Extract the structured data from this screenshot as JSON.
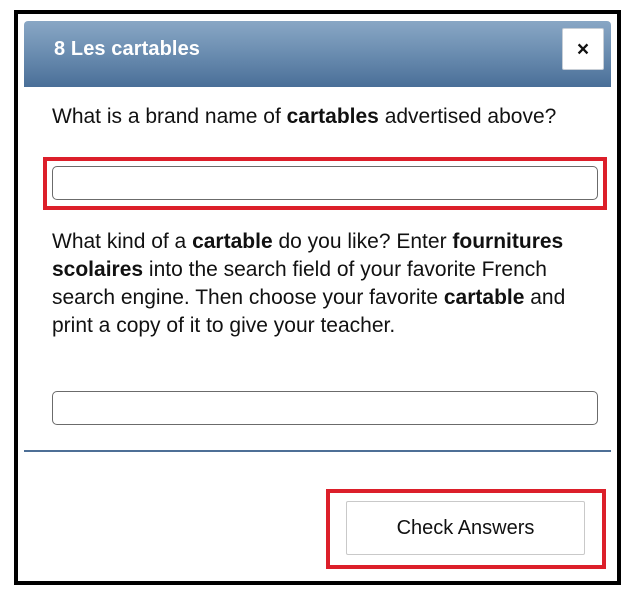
{
  "dialog": {
    "title": "8 Les cartables",
    "close_icon": "close-icon",
    "close_glyph": "×"
  },
  "question1": {
    "parts": [
      "What is a brand name of ",
      "cartables",
      " advertised above?"
    ],
    "answer_value": "",
    "answer_placeholder": ""
  },
  "question2": {
    "parts": [
      "What kind of a ",
      "cartable",
      " do you like? Enter ",
      "fournitures scolaires",
      " into the search field of your favorite French search engine. Then choose your favorite ",
      "cartable",
      " and print a copy of it to give your teacher."
    ],
    "answer_value": "",
    "answer_placeholder": ""
  },
  "footer": {
    "check_answers_label": "Check Answers"
  },
  "colors": {
    "titlebar_top": "#89a7c5",
    "titlebar_bottom": "#4a6f98",
    "highlight_red": "#dc1f2a",
    "divider_blue": "#4d6f96"
  }
}
